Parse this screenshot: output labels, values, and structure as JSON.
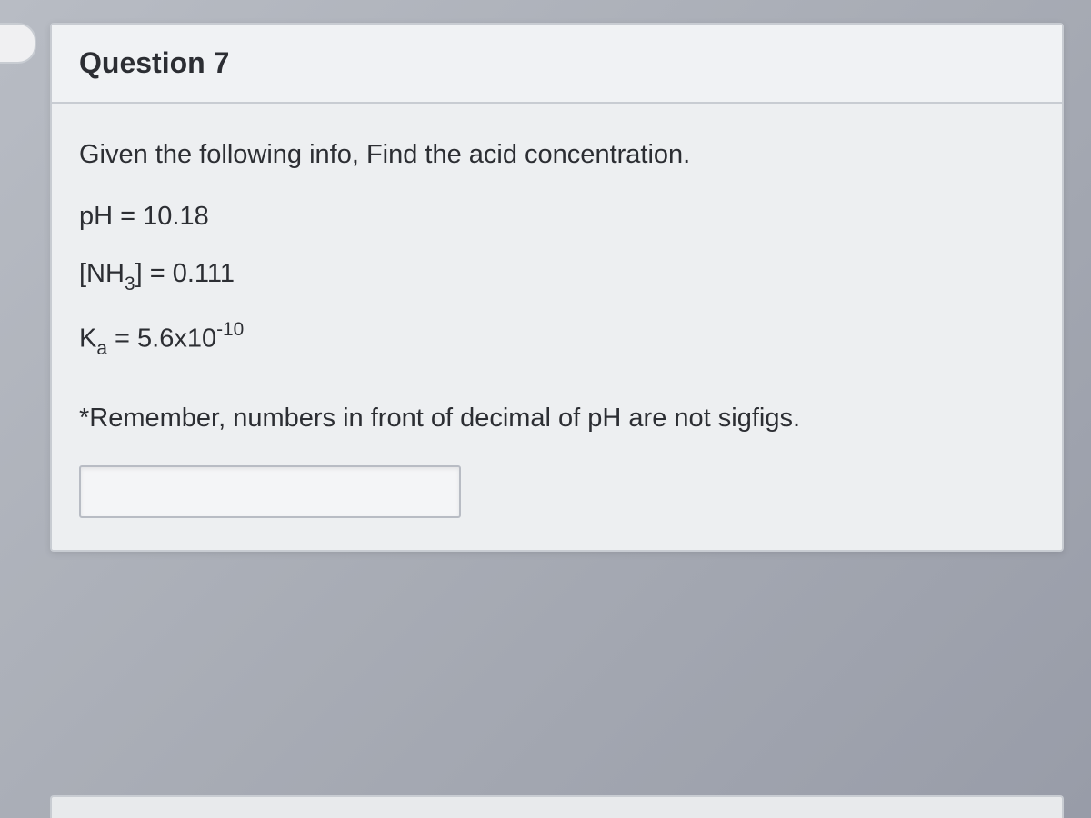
{
  "question": {
    "title": "Question 7",
    "prompt": "Given the following info, Find the acid concentration.",
    "ph_label": "pH = ",
    "ph_value": "10.18",
    "nh3_prefix": "[NH",
    "nh3_sub": "3",
    "nh3_suffix": "] = ",
    "nh3_value": "0.111",
    "ka_prefix": "K",
    "ka_sub": "a",
    "ka_mid": " = 5.6x10",
    "ka_sup": "-10",
    "note": "*Remember, numbers in front of decimal of pH are not sigfigs.",
    "answer_value": ""
  }
}
